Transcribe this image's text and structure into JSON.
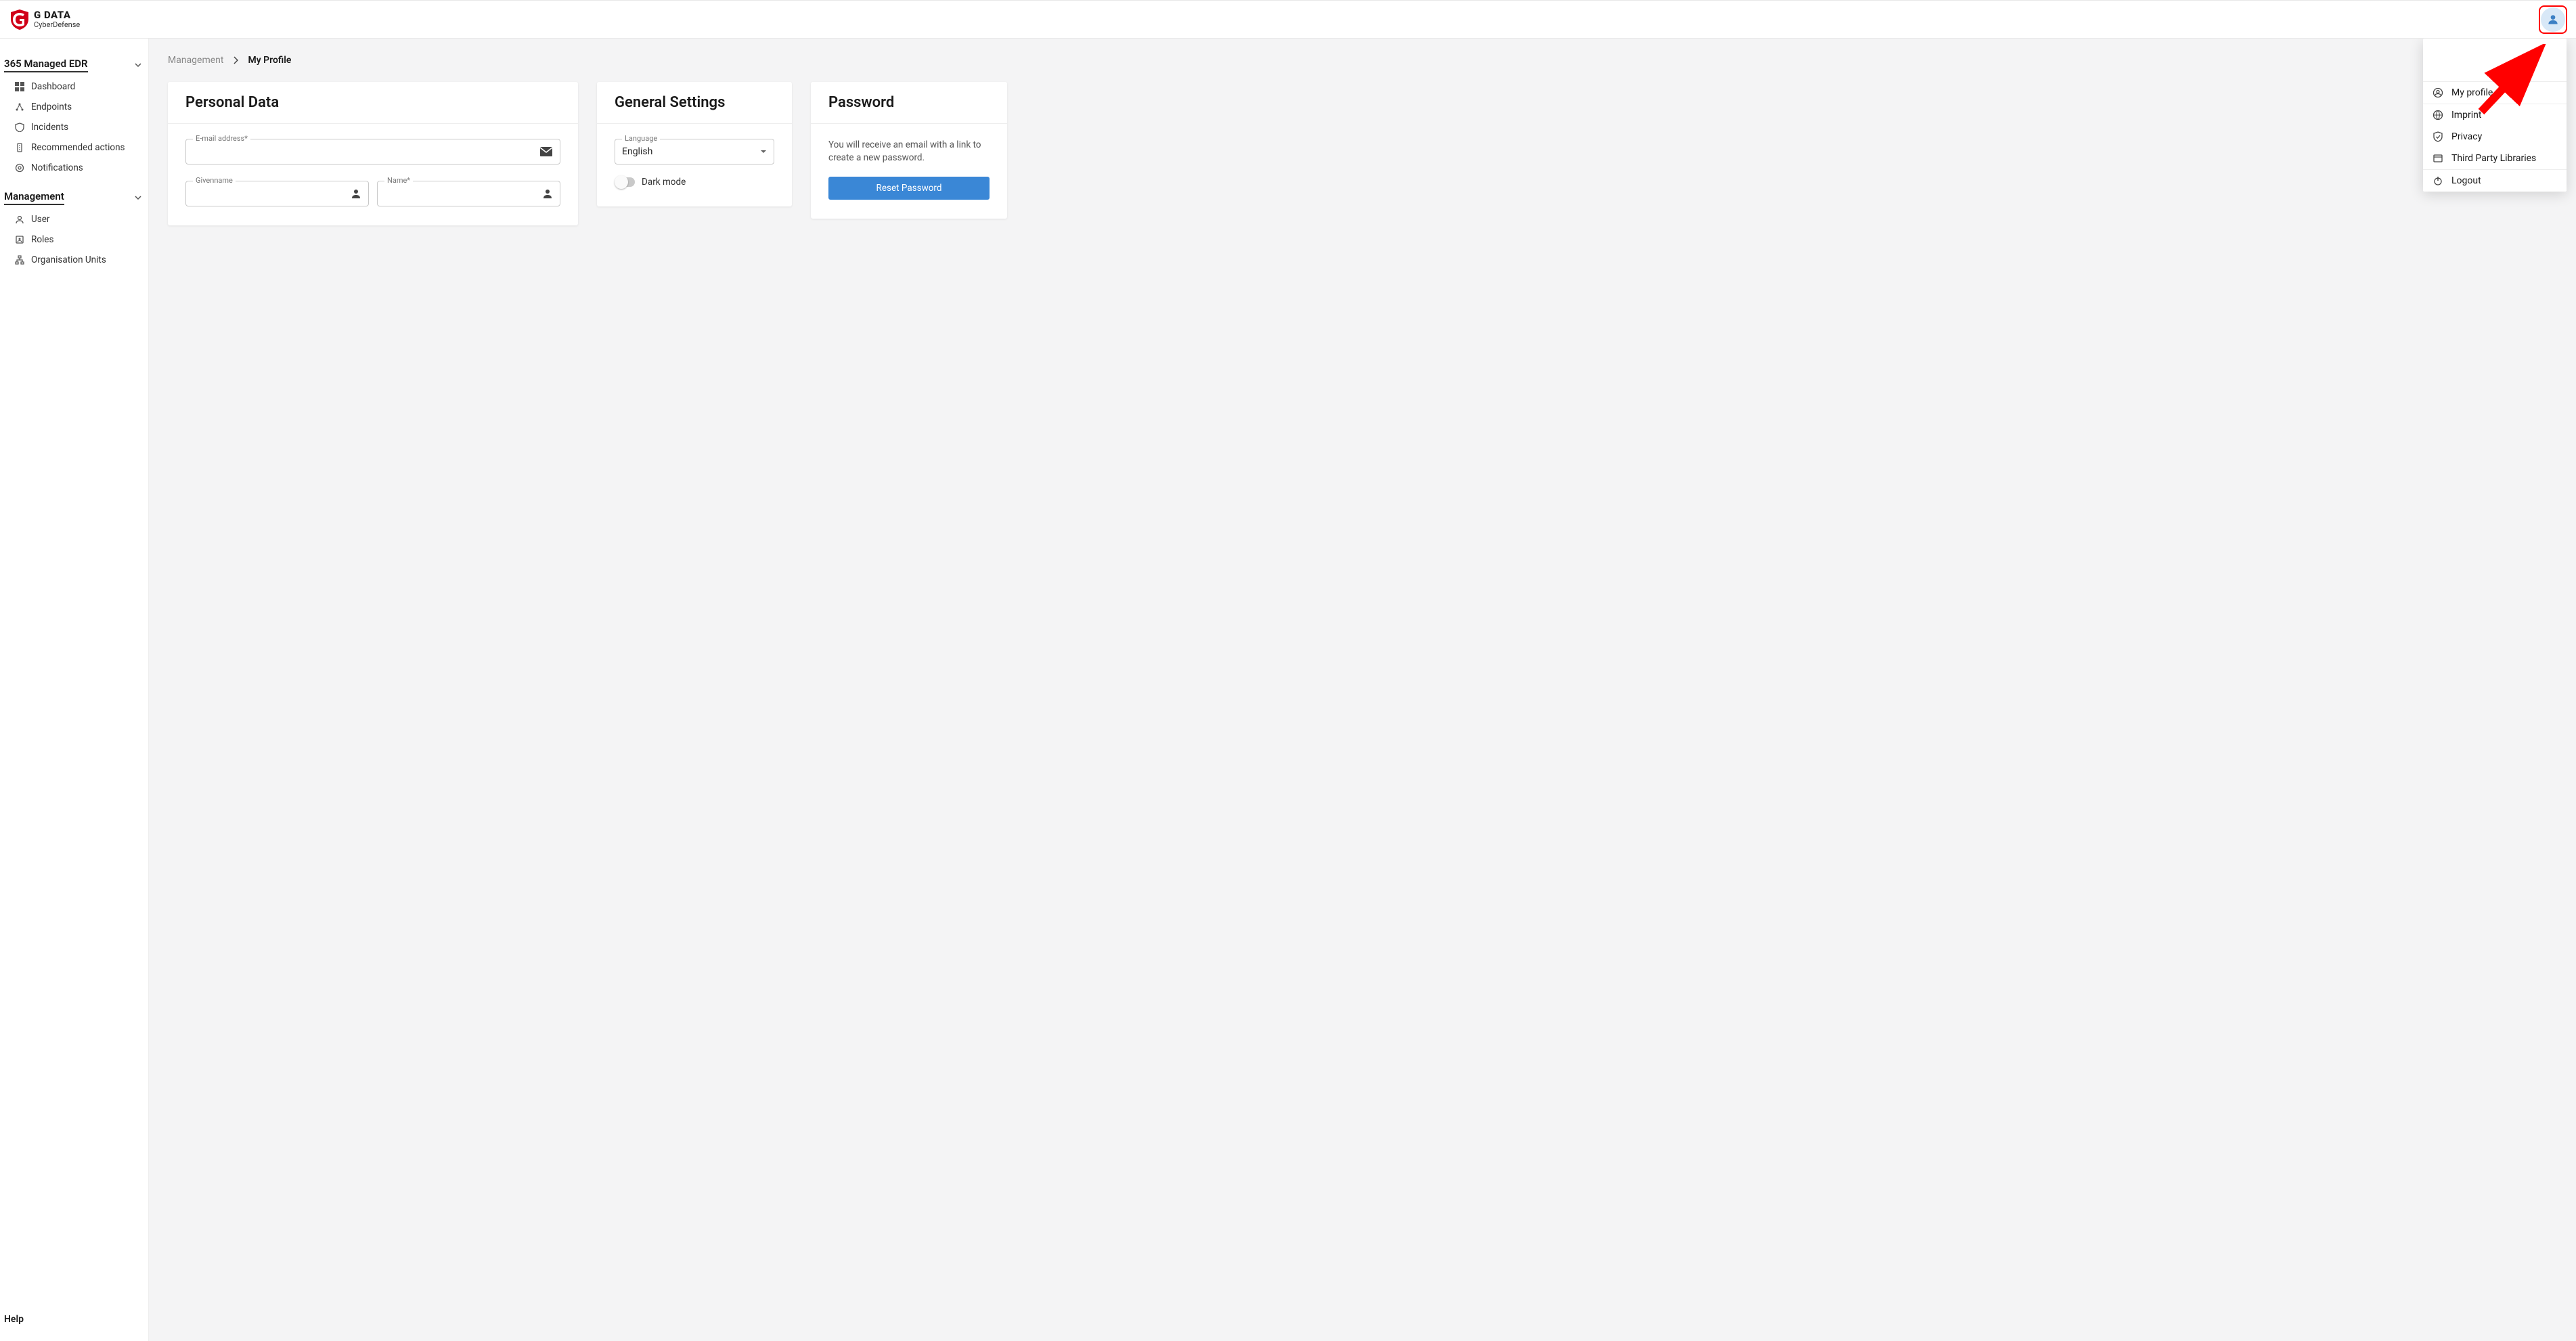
{
  "brand": {
    "line1": "G DATA",
    "line2": "CyberDefense"
  },
  "sidebar": {
    "section1": {
      "title": "365 Managed EDR",
      "items": [
        {
          "label": "Dashboard"
        },
        {
          "label": "Endpoints"
        },
        {
          "label": "Incidents"
        },
        {
          "label": "Recommended actions"
        },
        {
          "label": "Notifications"
        }
      ]
    },
    "section2": {
      "title": "Management",
      "items": [
        {
          "label": "User"
        },
        {
          "label": "Roles"
        },
        {
          "label": "Organisation Units"
        }
      ]
    },
    "help": "Help"
  },
  "breadcrumb": {
    "root": "Management",
    "current": "My Profile"
  },
  "personal": {
    "title": "Personal Data",
    "email_label": "E-mail address*",
    "given_label": "Givenname",
    "name_label": "Name*"
  },
  "settings": {
    "title": "General Settings",
    "language_label": "Language",
    "language_value": "English",
    "dark_mode_label": "Dark mode"
  },
  "password": {
    "title": "Password",
    "text": "You will receive an email with a link to create a new password.",
    "button": "Reset Password"
  },
  "dropdown": {
    "items": [
      {
        "label": "My profile"
      },
      {
        "label": "Imprint"
      },
      {
        "label": "Privacy"
      },
      {
        "label": "Third Party Libraries"
      },
      {
        "label": "Logout"
      }
    ]
  }
}
